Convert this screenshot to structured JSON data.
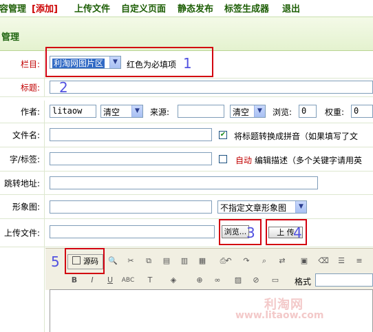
{
  "topnav": {
    "manage": "内容管理",
    "add": "[添加]",
    "upload": "上传文件",
    "custom_page": "自定义页面",
    "static_publish": "静态发布",
    "tag_gen": "标签生成器",
    "logout": "退出"
  },
  "section_title": "管理",
  "form": {
    "column_label": "栏目:",
    "column_value": "利淘网图片区",
    "column_hint": "红色为必填项",
    "title_label": "标题:",
    "author_label": "作者:",
    "author_value": "litaow",
    "clear_label": "清空",
    "source_label": "来源:",
    "source_value": "",
    "clear2_label": "清空",
    "views_label": "浏览:",
    "views_value": "0",
    "weight_label": "权重:",
    "weight_value": "0",
    "filename_label": "文件名:",
    "pinyin_label": "将标题转换成拼音（如果填写了文",
    "keyword_label": "字/标签:",
    "auto_label": "自动",
    "auto_desc": "编辑描述（多个关键字请用英",
    "redirect_label": "跳转地址:",
    "image_label": "形象图:",
    "image_select": "不指定文章形象图",
    "upload_label": "上传文件:",
    "browse_label": "浏览...",
    "upload_button": "上 传"
  },
  "editor": {
    "source_label": "源码",
    "format_label": "格式"
  },
  "annotations": [
    "1",
    "2",
    "3",
    "4",
    "5"
  ],
  "watermark": {
    "site_cn": "利淘网",
    "site_url": "www.litaow.com"
  },
  "colors": {
    "required": "#c00000",
    "annotation_box": "#d2000f",
    "annotation_number": "#5151e0",
    "nav_text": "#1d5e05"
  }
}
